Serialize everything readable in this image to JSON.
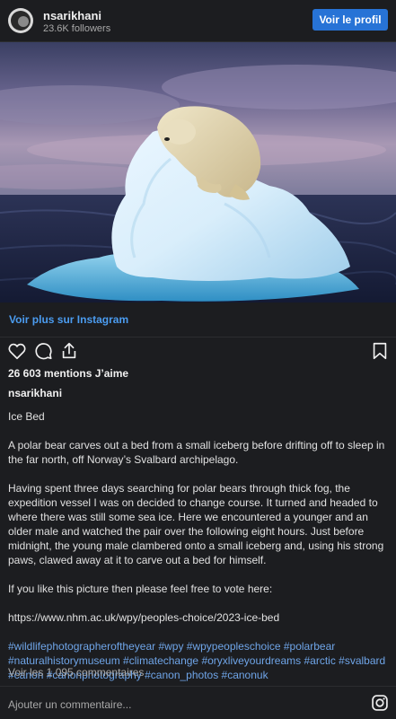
{
  "header": {
    "username": "nsarikhani",
    "followers": "23.6K followers",
    "profile_button": "Voir le profil"
  },
  "post": {
    "see_more": "Voir plus sur Instagram",
    "likes": "26 603 mentions J’aime",
    "caption_username": "nsarikhani",
    "caption_title": "Ice Bed",
    "caption_p1": "A polar bear carves out a bed from a small iceberg before drifting off to sleep in the far north, off Norway’s Svalbard archipelago.",
    "caption_p2": "Having spent three days searching for polar bears through thick fog, the expedition vessel I was on decided to change course. It turned and headed to where there was still some sea ice. Here we encountered a younger and an older male and watched the pair over the following eight hours. Just before midnight, the young male clambered onto a small iceberg and, using his strong paws, clawed away at it to carve out a bed for himself.",
    "caption_p3": "If you like this picture then please feel free to vote here:",
    "caption_link": "https://www.nhm.ac.uk/wpy/peoples-choice/2023-ice-bed",
    "hashtags": "#wildlifephotographeroftheyear #wpy #wpypeopleschoice #polarbear #naturalhistorymuseum #climatechange #oryxliveyourdreams #arctic #svalbard #canon #canonphotography #canon_photos #canonuk",
    "comments": "Voir les 1 095 commentaires",
    "add_comment": "Ajouter un commentaire..."
  },
  "icons": [
    "heart-icon",
    "comment-icon",
    "share-icon",
    "bookmark-icon",
    "instagram-icon"
  ],
  "colors": {
    "background": "#1c1d20",
    "button": "#2773d6",
    "link": "#4b9cf0",
    "hashtag": "#6fa5e8",
    "secondary_text": "#a8a8a8"
  }
}
